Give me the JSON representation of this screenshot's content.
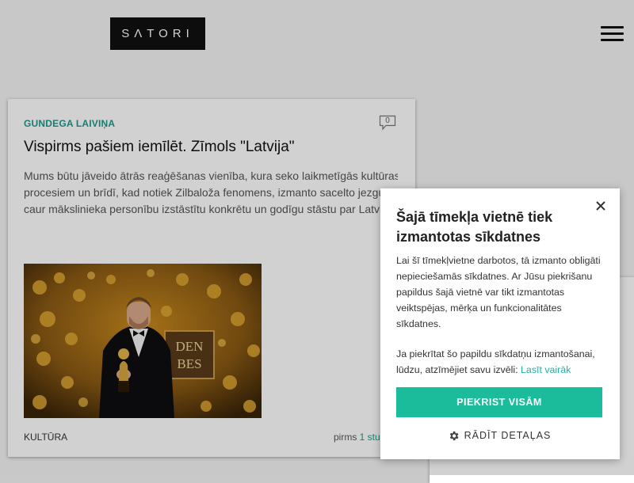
{
  "header": {
    "logo_text": "SΛTORI",
    "menu_icon": "hamburger-icon"
  },
  "article": {
    "author": "GUNDEGA LAIVIŅA",
    "comment_count": "0",
    "title": "Vispirms pašiem iemīlēt. Zīmols \"Latvija\"",
    "excerpt_lines": [
      "Mums būtu jāveido ātrās reaģēšanas vienība, kura seko laikmetīgās kultūras",
      "procesiem un brīdī, kad notiek Zilbaloža fenomens, izmanto sacelto jezgu, lai",
      "caur mākslinieka personību izstāstītu konkrētu un godīgu stāstu par Latviju"
    ],
    "photo_sign_text": "DEN\nBES",
    "category": "KULTŪRA",
    "time_prefix": "pirms ",
    "time_link": "1 stu"
  },
  "cookie": {
    "title": "Šajā tīmekļa vietnē tiek izmantotas sīkdatnes",
    "paragraph1": "Lai šī tīmekļvietne darbotos, tā izmanto obligāti nepieciešamās sīkdatnes. Ar Jūsu piekrišanu papildus šajā vietnē var tikt izmantotas veiktspējas, mērķa un funkcionalitātes sīkdatnes.",
    "paragraph2": "Ja piekrītat šo papildu sīkdatņu izmantošanai, lūdzu, atzīmējiet savu izvēli:",
    "read_more": "Lasīt vairāk",
    "accept_label": "PIEKRIST VISĀM",
    "details_label": "RĀDĪT DETAĻAS",
    "colors": {
      "accent": "#1abc9c",
      "link": "#1ab3a6"
    }
  }
}
